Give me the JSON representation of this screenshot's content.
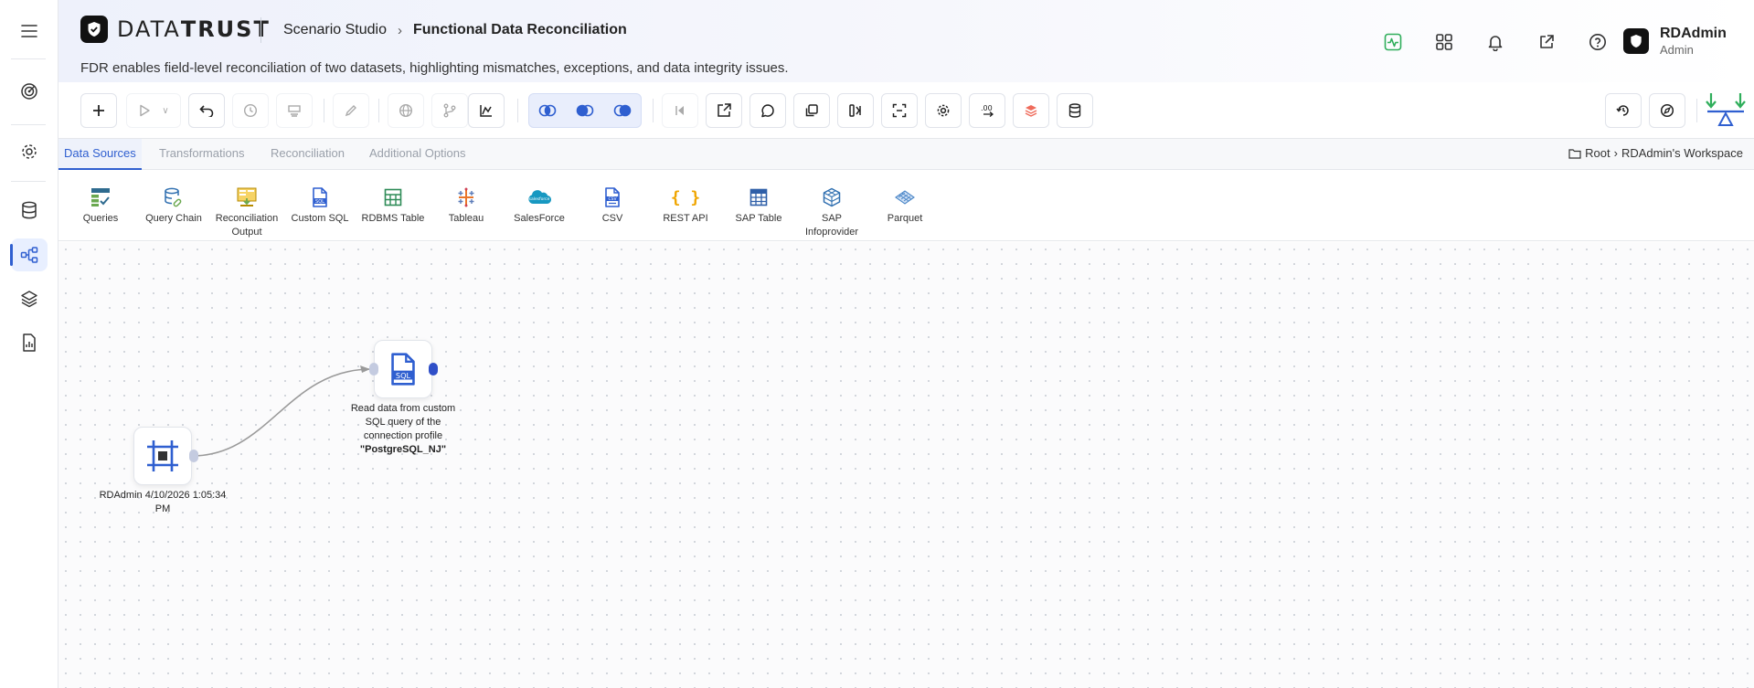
{
  "brand": {
    "name_light": "DATA",
    "name_bold": "TRUST"
  },
  "breadcrumb": {
    "parent": "Scenario Studio",
    "current": "Functional Data Reconciliation"
  },
  "description": "FDR enables field-level reconciliation of two datasets, highlighting mismatches, exceptions, and data integrity issues.",
  "user": {
    "name": "RDAdmin",
    "role": "Admin"
  },
  "header_icons": [
    "activity-icon",
    "grid-icon",
    "bell-icon",
    "external-link-icon",
    "help-icon"
  ],
  "rail_icons": [
    "menu-icon",
    "target-icon",
    "settings-icon",
    "database-icon",
    "flow-icon",
    "layers-icon",
    "report-icon"
  ],
  "tabs": [
    {
      "label": "Data Sources",
      "active": true
    },
    {
      "label": "Transformations",
      "active": false
    },
    {
      "label": "Reconciliation",
      "active": false
    },
    {
      "label": "Additional Options",
      "active": false
    }
  ],
  "workspace": {
    "root": "Root",
    "name": "RDAdmin's Workspace"
  },
  "palette": [
    {
      "label": "Queries",
      "icon": "queries-icon"
    },
    {
      "label": "Query Chain",
      "icon": "query-chain-icon"
    },
    {
      "label": "Reconciliation Output",
      "icon": "recon-output-icon"
    },
    {
      "label": "Custom SQL",
      "icon": "sql-file-icon"
    },
    {
      "label": "RDBMS Table",
      "icon": "table-icon"
    },
    {
      "label": "Tableau",
      "icon": "tableau-icon"
    },
    {
      "label": "SalesForce",
      "icon": "salesforce-cloud-icon"
    },
    {
      "label": "CSV",
      "icon": "csv-file-icon"
    },
    {
      "label": "REST API",
      "icon": "braces-icon"
    },
    {
      "label": "SAP Table",
      "icon": "sap-table-icon"
    },
    {
      "label": "SAP Infoprovider",
      "icon": "cube-icon"
    },
    {
      "label": "Parquet",
      "icon": "parquet-icon"
    }
  ],
  "canvas": {
    "start_node": {
      "label": "RDAdmin 4/10/2026 1:05:34 PM"
    },
    "sql_node": {
      "label_prefix": "Read data from custom SQL query of the connection profile ",
      "profile": "\"PostgreSQL_NJ\""
    }
  },
  "colors": {
    "accent": "#2f5fd0",
    "active_tab_bg": "#eef2fb",
    "green": "#2fae5b"
  }
}
